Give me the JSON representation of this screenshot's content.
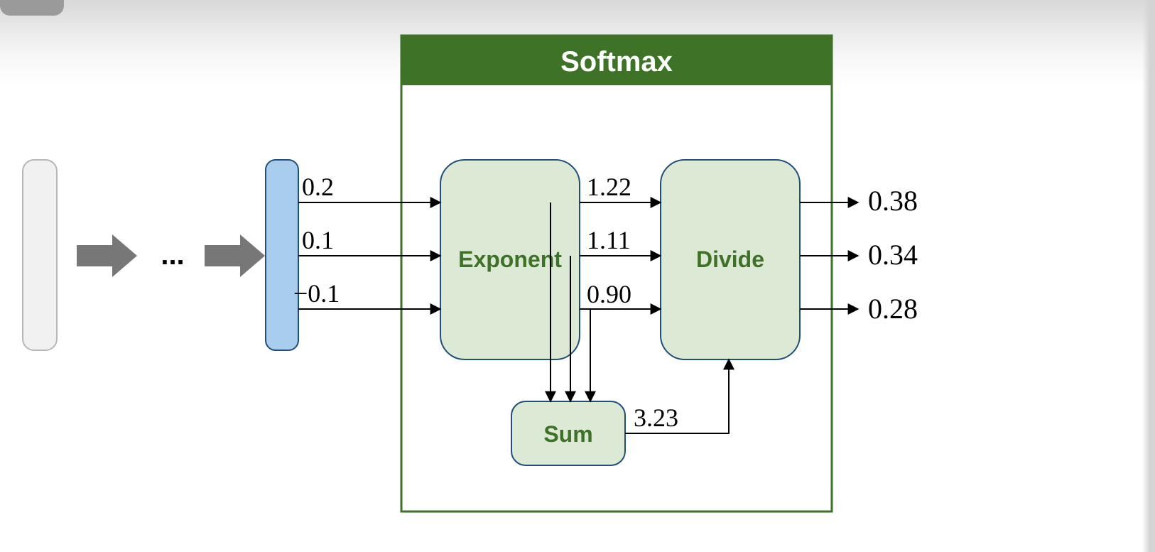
{
  "title": "Softmax",
  "nodes": {
    "exponent": "Exponent",
    "sum": "Sum",
    "divide": "Divide"
  },
  "ellipsis": "...",
  "inputs": [
    "0.2",
    "0.1",
    "−0.1"
  ],
  "exponents": [
    "1.22",
    "1.11",
    "0.90"
  ],
  "sum_value": "3.23",
  "outputs": [
    "0.38",
    "0.34",
    "0.28"
  ]
}
